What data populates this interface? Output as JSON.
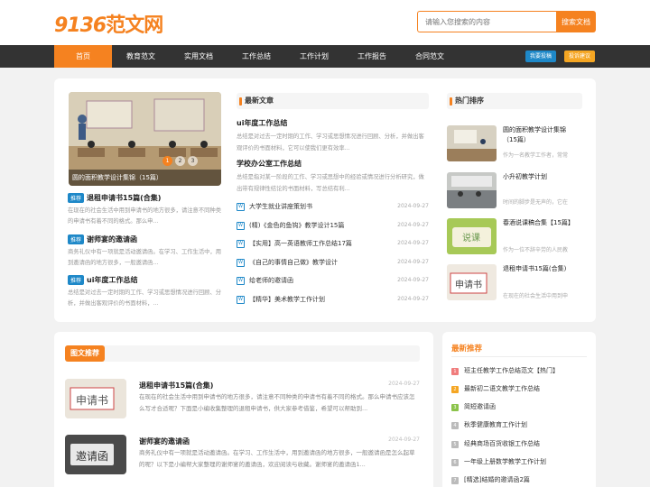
{
  "logo": {
    "num": "9136",
    "cn": "范文网"
  },
  "search": {
    "placeholder": "请输入您搜索的内容",
    "button": "搜索文档"
  },
  "nav": {
    "items": [
      "首页",
      "教育范文",
      "实用文档",
      "工作总结",
      "工作计划",
      "工作报告",
      "合同范文"
    ],
    "btn_login": "我要投稿",
    "btn_feedback": "投诉建议",
    "btn_login_color": "#1e88c8",
    "btn_feedback_color": "#f5a623"
  },
  "colors": {
    "accent": "#f58220",
    "tag": "#1e88c8",
    "nav_bg": "#333333"
  },
  "slider": {
    "caption": "圆的面积教学设计集锦（15篇）",
    "dots": [
      "1",
      "2",
      "3"
    ]
  },
  "recommend": [
    {
      "tag": "推荐",
      "title": "退租申请书15篇(合集)",
      "desc": "在现在的社会生活中用到申请书的地方很多，请注意不同种类的申请书有着不同的格式。那么申..."
    },
    {
      "tag": "推荐",
      "title": "谢师宴的邀请函",
      "desc": "商务礼仪中有一项就是活动邀请函。在学习、工作生活中，用到邀请函的地方很多，一般邀请函..."
    },
    {
      "tag": "推荐",
      "title": "ui年度工作总结",
      "desc": "总结是对过去一定时期的工作、学习或思想情况进行回顾、分析，并做出客观评价的书面材料，..."
    }
  ],
  "latest": {
    "header": "最新文章",
    "featured": [
      {
        "title": "ui年度工作总结",
        "desc": "总结是对过去一定时期的工作、学习或思想情况进行回顾、分析，并做出客观评价的书面材料，它可以使我们更有效率..."
      },
      {
        "title": "学校办公室工作总结",
        "desc": "总结是指对某一阶段的工作、学习或思想中的经验或情况进行分析研究，做出带有规律性结论的书面材料，写总结有利..."
      }
    ],
    "list": [
      {
        "title": "大学生就业讲座策划书",
        "date": "2024-09-27"
      },
      {
        "title": "(精)《金色的鱼钩》教学设计15篇",
        "date": "2024-09-27"
      },
      {
        "title": "【实用】高一英语教师工作总结17篇",
        "date": "2024-09-27"
      },
      {
        "title": "《自己的事情自己做》教学设计",
        "date": "2024-09-27"
      },
      {
        "title": "给老师的邀请函",
        "date": "2024-09-27"
      },
      {
        "title": "【精华】美术教学工作计划",
        "date": "2024-09-27"
      }
    ],
    "icon_glyph": "W"
  },
  "hot": {
    "header": "热门排序",
    "items": [
      {
        "title": "圆的面积教学设计集锦（15篇）",
        "desc": "作为一名教学工作者，常常"
      },
      {
        "title": "小升初教学计划",
        "desc": "时间的脚步是无声的，它在"
      },
      {
        "title": "春酒说课稿合集【15篇】",
        "desc": "作为一位不辞辛劳的人民教"
      },
      {
        "title": "退租申请书15篇(合集)",
        "desc": "在现在的社会生活中用到申"
      }
    ]
  },
  "articles": {
    "header": "图文推荐",
    "items": [
      {
        "title": "退租申请书15篇(合集)",
        "date": "2024-09-27",
        "img_text": "申请书",
        "desc": "在现在的社会生活中用到申请书的地方很多，请注意不同种类的申请书有着不同的格式。那么申请书应该怎么写才合适呢？下面是小编收集整理的退租申请书，供大家参考借鉴，希望可以帮助到..."
      },
      {
        "title": "谢师宴的邀请函",
        "date": "2024-09-27",
        "img_text": "邀请函",
        "desc": "商务礼仪中有一项就是活动邀请函。在学习、工作生活中，用到邀请函的地方很多，一般邀请函是怎么起草的呢？以下是小编帮大家整理的谢师宴的邀请函，欢迎阅读与收藏。谢师宴的邀请函1..."
      }
    ]
  },
  "newrec": {
    "header": "最新推荐",
    "items": [
      {
        "n": "1",
        "title": "班主任教学工作总结范文【热门】",
        "color": "#f07c7c"
      },
      {
        "n": "2",
        "title": "最新初二语文教学工作总结",
        "color": "#f5a623"
      },
      {
        "n": "3",
        "title": "简短邀请函",
        "color": "#8bc34a"
      },
      {
        "n": "4",
        "title": "秋季健康教育工作计划",
        "color": "#bbbbbb"
      },
      {
        "n": "5",
        "title": "经典商场百货收银工作总结",
        "color": "#bbbbbb"
      },
      {
        "n": "6",
        "title": "一年级上册数学教学工作计划",
        "color": "#bbbbbb"
      },
      {
        "n": "7",
        "title": "[精选]结婚的邀请函2篇",
        "color": "#bbbbbb"
      }
    ]
  }
}
